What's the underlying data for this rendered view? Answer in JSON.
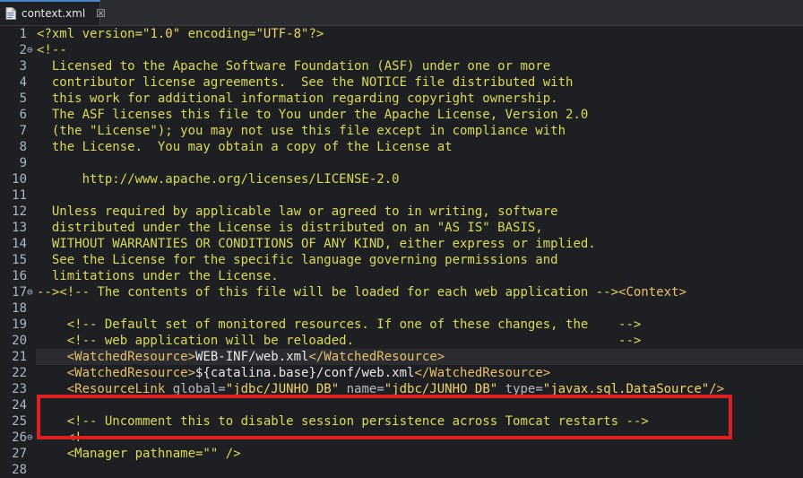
{
  "tab": {
    "title": "context.xml",
    "close_glyph": "☒"
  },
  "lines": [
    {
      "n": "1",
      "fold": "",
      "segments": [
        [
          "c-comment",
          "<?xml version="
        ],
        [
          "c-str",
          "\"1.0\""
        ],
        [
          "c-comment",
          " encoding="
        ],
        [
          "c-str",
          "\"UTF-8\""
        ],
        [
          "c-comment",
          "?>"
        ]
      ]
    },
    {
      "n": "2",
      "fold": "⊖",
      "segments": [
        [
          "c-comment",
          "<!--"
        ]
      ]
    },
    {
      "n": "3",
      "fold": "",
      "segments": [
        [
          "c-comment",
          "  Licensed to the Apache Software Foundation (ASF) under one or more"
        ]
      ]
    },
    {
      "n": "4",
      "fold": "",
      "segments": [
        [
          "c-comment",
          "  contributor license agreements.  See the NOTICE file distributed with"
        ]
      ]
    },
    {
      "n": "5",
      "fold": "",
      "segments": [
        [
          "c-comment",
          "  this work for additional information regarding copyright ownership."
        ]
      ]
    },
    {
      "n": "6",
      "fold": "",
      "segments": [
        [
          "c-comment",
          "  The ASF licenses this file to You under the Apache License, Version 2.0"
        ]
      ]
    },
    {
      "n": "7",
      "fold": "",
      "segments": [
        [
          "c-comment",
          "  (the \"License\"); you may not use this file except in compliance with"
        ]
      ]
    },
    {
      "n": "8",
      "fold": "",
      "segments": [
        [
          "c-comment",
          "  the License.  You may obtain a copy of the License at"
        ]
      ]
    },
    {
      "n": "9",
      "fold": "",
      "segments": [
        [
          "c-comment",
          ""
        ]
      ]
    },
    {
      "n": "10",
      "fold": "",
      "segments": [
        [
          "c-comment",
          "      http://www.apache.org/licenses/LICENSE-2.0"
        ]
      ]
    },
    {
      "n": "11",
      "fold": "",
      "segments": [
        [
          "c-comment",
          ""
        ]
      ]
    },
    {
      "n": "12",
      "fold": "",
      "segments": [
        [
          "c-comment",
          "  Unless required by applicable law or agreed to in writing, software"
        ]
      ]
    },
    {
      "n": "13",
      "fold": "",
      "segments": [
        [
          "c-comment",
          "  distributed under the License is distributed on an \"AS IS\" BASIS,"
        ]
      ]
    },
    {
      "n": "14",
      "fold": "",
      "segments": [
        [
          "c-comment",
          "  WITHOUT WARRANTIES OR CONDITIONS OF ANY KIND, either express or implied."
        ]
      ]
    },
    {
      "n": "15",
      "fold": "",
      "segments": [
        [
          "c-comment",
          "  See the License for the specific language governing permissions and"
        ]
      ]
    },
    {
      "n": "16",
      "fold": "",
      "segments": [
        [
          "c-comment",
          "  limitations under the License."
        ]
      ]
    },
    {
      "n": "17",
      "fold": "⊖",
      "segments": [
        [
          "c-comment",
          "--><!-- The contents of this file will be loaded for each web application -->"
        ],
        [
          "c-tagname",
          "<Context>"
        ]
      ]
    },
    {
      "n": "18",
      "fold": "",
      "segments": [
        [
          "c-comment",
          ""
        ]
      ]
    },
    {
      "n": "19",
      "fold": "",
      "segments": [
        [
          "c-comment",
          "    <!-- Default set of monitored resources. If one of these changes, the    -->"
        ]
      ]
    },
    {
      "n": "20",
      "fold": "",
      "segments": [
        [
          "c-comment",
          "    <!-- web application will be reloaded.                                   -->"
        ]
      ]
    },
    {
      "n": "21",
      "fold": "",
      "segments": [
        [
          "c-text",
          "    "
        ],
        [
          "c-tagname",
          "<WatchedResource>"
        ],
        [
          "c-text",
          "WEB-INF/web.xml"
        ],
        [
          "c-tagname",
          "</WatchedResource>"
        ]
      ]
    },
    {
      "n": "22",
      "fold": "",
      "segments": [
        [
          "c-text",
          "    "
        ],
        [
          "c-tagname",
          "<WatchedResource>"
        ],
        [
          "c-text",
          "${catalina.base}/conf/web.xml"
        ],
        [
          "c-tagname",
          "</WatchedResource>"
        ]
      ]
    },
    {
      "n": "23",
      "fold": "",
      "segments": [
        [
          "c-text",
          "    "
        ],
        [
          "c-tagname",
          "<ResourceLink"
        ],
        [
          "c-attr",
          " global="
        ],
        [
          "c-str",
          "\"jdbc/JUNHO_DB\""
        ],
        [
          "c-attr",
          " name="
        ],
        [
          "c-str",
          "\"jdbc/JUNHO_DB\""
        ],
        [
          "c-attr",
          " type="
        ],
        [
          "c-str",
          "\"javax.sql.DataSource\""
        ],
        [
          "c-tagname",
          "/>"
        ]
      ]
    },
    {
      "n": "24",
      "fold": "",
      "segments": [
        [
          "c-text",
          ""
        ]
      ]
    },
    {
      "n": "25",
      "fold": "",
      "segments": [
        [
          "c-comment",
          "    <!-- Uncomment this to disable session persistence across Tomcat restarts -->"
        ]
      ]
    },
    {
      "n": "26",
      "fold": "⊖",
      "segments": [
        [
          "c-comment",
          "    <!--"
        ]
      ]
    },
    {
      "n": "27",
      "fold": "",
      "segments": [
        [
          "c-comment",
          "    <Manager pathname=\"\" />"
        ]
      ]
    },
    {
      "n": "28",
      "fold": "",
      "segments": [
        [
          "c-comment",
          ""
        ]
      ]
    }
  ],
  "highlight_line": "21",
  "annotation": {
    "color": "#e02020",
    "wraps_line": "23"
  }
}
